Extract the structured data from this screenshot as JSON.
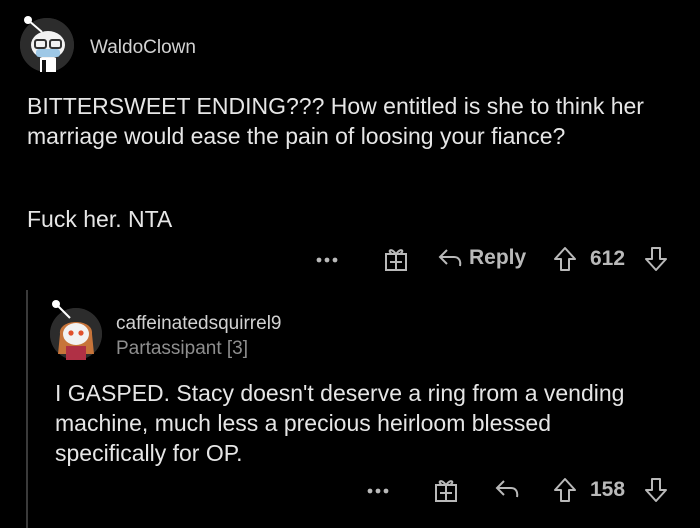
{
  "comment1": {
    "username": "WaldoClown",
    "paragraphs": [
      "BITTERSWEET ENDING??? How entitled is she to think her marriage would ease the pain of loosing your fiance?",
      "Fuck her. NTA"
    ],
    "actions": {
      "more_icon": "more-dots",
      "award_icon": "gift-icon",
      "reply_label": "Reply",
      "score": "612"
    }
  },
  "comment2": {
    "username": "caffeinatedsquirrel9",
    "flair": "Partassipant [3]",
    "body": "I GASPED. Stacy doesn't deserve a ring from a vending machine, much less a precious heirloom blessed specifically for OP.",
    "actions": {
      "more_icon": "more-dots",
      "award_icon": "gift-icon",
      "score": "158"
    }
  },
  "colors": {
    "background": "#000000",
    "text": "#e6e6e6",
    "muted": "#8e8e8e",
    "icon": "#b9b9b9"
  }
}
